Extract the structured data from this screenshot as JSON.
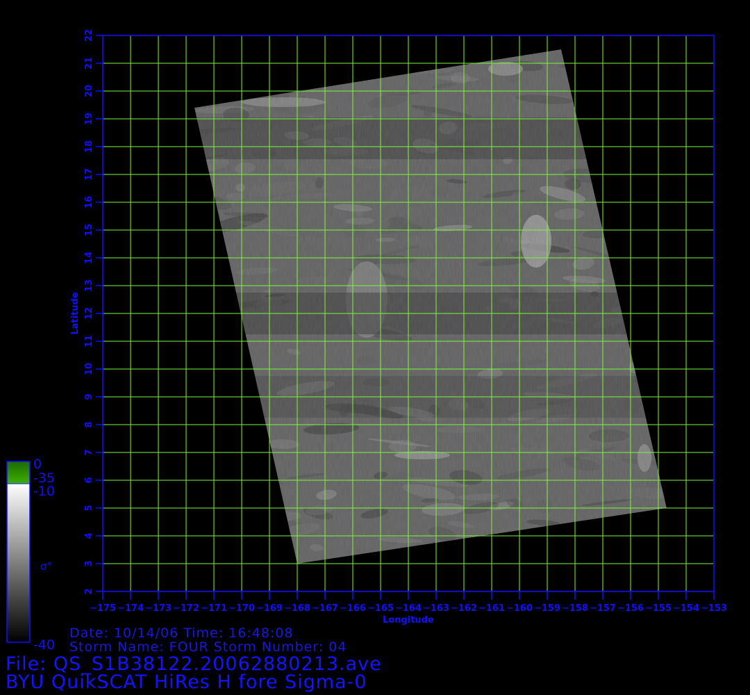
{
  "colors": {
    "axis": "#1010ff",
    "grid": "#7cf83a",
    "background": "#000000",
    "land_mask": "#3aa500"
  },
  "map": {
    "x_axis": {
      "label": "Longitude",
      "min": -175,
      "max": -153,
      "ticks": [
        "-175",
        "-174",
        "-173",
        "-172",
        "-171",
        "-170",
        "-169",
        "-168",
        "-167",
        "-166",
        "-165",
        "-164",
        "-163",
        "-162",
        "-161",
        "-160",
        "-159",
        "-158",
        "-157",
        "-156",
        "-155",
        "-154",
        "-153"
      ]
    },
    "y_axis": {
      "label": "Latitude",
      "min": 2,
      "max": 22,
      "ticks": [
        "2",
        "3",
        "4",
        "5",
        "6",
        "7",
        "8",
        "9",
        "10",
        "11",
        "12",
        "13",
        "14",
        "15",
        "16",
        "17",
        "18",
        "19",
        "20",
        "21",
        "22"
      ]
    },
    "grid": true,
    "swath_corners": [
      {
        "lon": -171.7,
        "lat": 19.4
      },
      {
        "lon": -158.5,
        "lat": 21.5
      },
      {
        "lon": -154.7,
        "lat": 5.0
      },
      {
        "lon": -168.0,
        "lat": 3.0
      }
    ]
  },
  "colorbar": {
    "symbol": "σ°",
    "labels": {
      "top": "0",
      "land_bottom": "-35",
      "gray_top": "-10",
      "bottom": "-40"
    }
  },
  "info": {
    "line1": "Date: 10/14/06   Time: 16:48:08",
    "line2": "Storm  Name: FOUR   Storm  Number: 04",
    "file": "File: QS_S1B38122.20062880213.ave",
    "product": "BYU QuikSCAT HiRes H fore Sigma-0"
  }
}
